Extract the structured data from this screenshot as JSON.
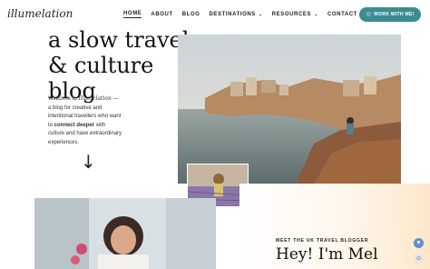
{
  "logo": {
    "text": "illumelation"
  },
  "nav": {
    "items": [
      {
        "label": "HOME"
      },
      {
        "label": "ABOUT"
      },
      {
        "label": "BLOG"
      },
      {
        "label": "DESTINATIONS"
      },
      {
        "label": "RESOURCES"
      },
      {
        "label": "CONTACT"
      }
    ],
    "cta_label": "WORK WITH ME!"
  },
  "hero": {
    "title": "a slow travel & culture blog",
    "intro_prefix": "Welcome to ",
    "intro_brand": "Illumelation",
    "intro_mid": " — a blog for creative and intentional travellers who want to ",
    "intro_bold": "connect deeper",
    "intro_suffix": " with culture and have extraordinary experiences."
  },
  "about": {
    "eyebrow": "MEET THE UK TRAVEL BLOGGER",
    "heading": "Hey! I'm Mel"
  },
  "icons": {
    "arrow": "arrow-down-icon",
    "heart": "heart-icon",
    "accessibility": "accessibility-icon",
    "chevron": "chevron-down-icon"
  },
  "colors": {
    "accent": "#3c8d93",
    "peach": "#fde7c9",
    "heart": "#5b8ed6"
  }
}
